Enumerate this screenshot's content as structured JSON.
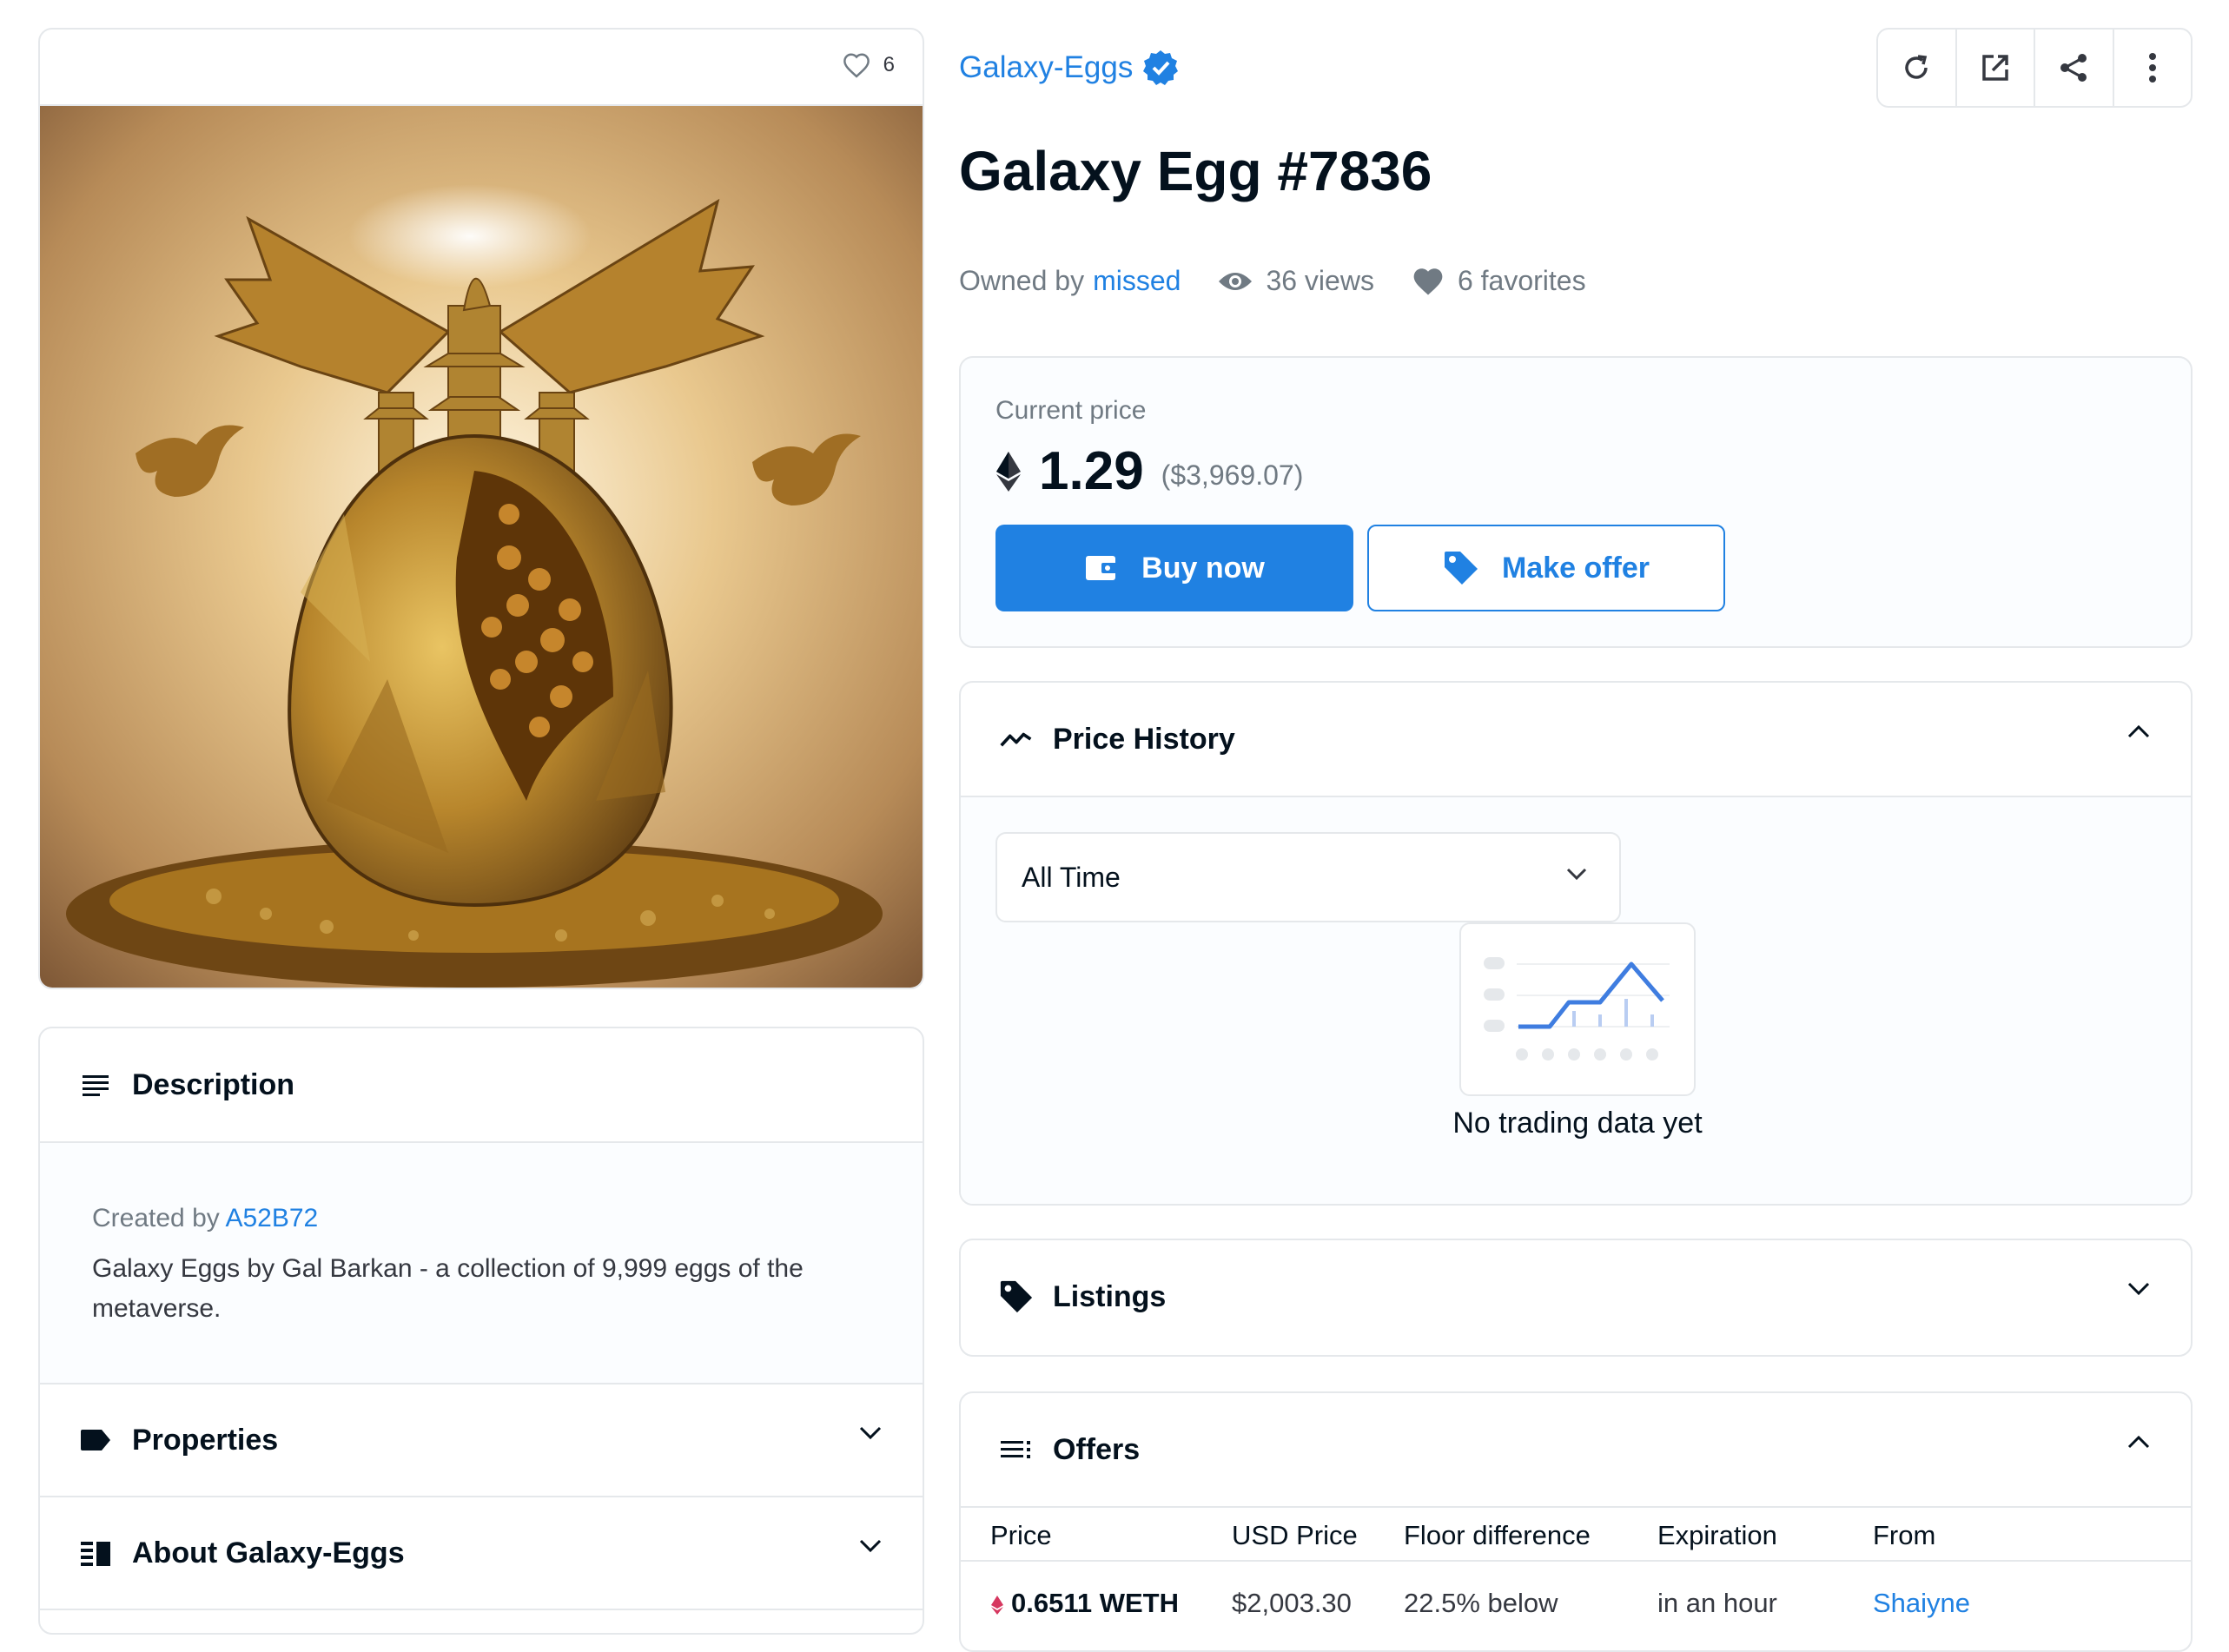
{
  "image_panel": {
    "favorites_count": "6"
  },
  "description": {
    "title": "Description",
    "created_by_label": "Created by",
    "creator": "A52B72",
    "text": "Galaxy Eggs by Gal Barkan - a collection of 9,999 eggs of the metaverse."
  },
  "properties": {
    "title": "Properties"
  },
  "about": {
    "title": "About Galaxy-Eggs"
  },
  "collection": {
    "name": "Galaxy-Eggs",
    "verified": true
  },
  "actions": [
    "refresh-icon",
    "open-external-icon",
    "share-icon",
    "more-icon"
  ],
  "item": {
    "title": "Galaxy Egg #7836",
    "owned_by_label": "Owned by",
    "owner": "missed",
    "views": "36 views",
    "favorites": "6 favorites"
  },
  "price": {
    "label": "Current price",
    "value": "1.29",
    "usd": "($3,969.07)",
    "buy_label": "Buy now",
    "offer_label": "Make offer"
  },
  "price_history": {
    "title": "Price History",
    "range": "All Time",
    "empty_text": "No trading data yet"
  },
  "listings": {
    "title": "Listings"
  },
  "offers": {
    "title": "Offers",
    "columns": [
      "Price",
      "USD Price",
      "Floor difference",
      "Expiration",
      "From"
    ],
    "rows": [
      {
        "price": "0.6511 WETH",
        "usd": "$2,003.30",
        "floor": "22.5% below",
        "expiration": "in an hour",
        "from": "Shaiyne"
      }
    ]
  },
  "colors": {
    "accent": "#2081e2",
    "border": "#e5e8eb",
    "text": "#04111d",
    "muted": "#707a83"
  }
}
